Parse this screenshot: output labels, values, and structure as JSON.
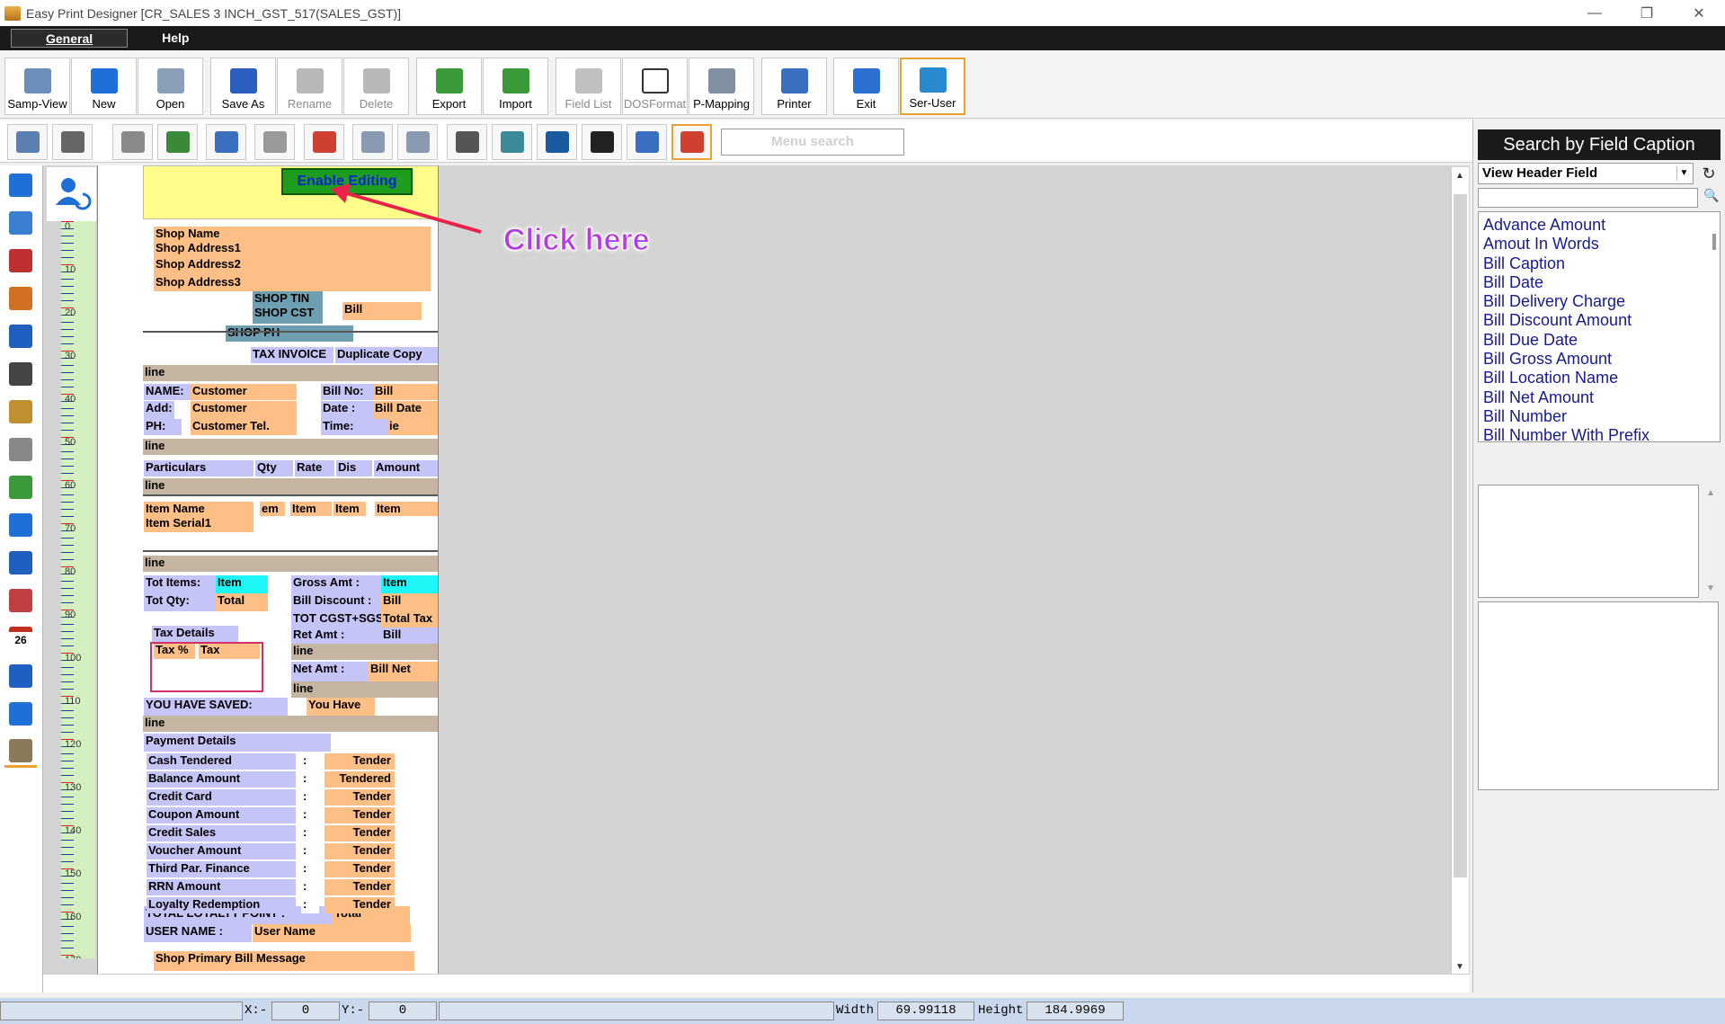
{
  "window": {
    "title": "Easy Print Designer [CR_SALES 3 INCH_GST_517(SALES_GST)]",
    "minimize": "—",
    "restore": "❐",
    "close": "✕"
  },
  "menu": {
    "items": [
      "General",
      "Help"
    ]
  },
  "toolbar": [
    {
      "label": "Samp-View",
      "icon": "magnifier-icon",
      "color": "#6b8fb8"
    },
    {
      "label": "New",
      "icon": "new-doc-icon",
      "color": "#1f6fd6"
    },
    {
      "label": "Open",
      "icon": "open-icon",
      "color": "#8aa0b8"
    },
    {
      "label": "Save As",
      "icon": "floppy-icon",
      "color": "#2a5fc0"
    },
    {
      "label": "Rename",
      "icon": "rename-icon",
      "color": "#b8b8b8"
    },
    {
      "label": "Delete",
      "icon": "delete-icon",
      "color": "#b8b8b8"
    },
    {
      "label": "Export",
      "icon": "export-icon",
      "color": "#3a9a3a"
    },
    {
      "label": "Import",
      "icon": "import-icon",
      "color": "#3a9a3a"
    },
    {
      "label": "Field List",
      "icon": "field-list-icon",
      "color": "#c0c0c0"
    },
    {
      "label": "DOSFormat",
      "icon": "dos-format-icon",
      "color": "#ffffff"
    },
    {
      "label": "P-Mapping",
      "icon": "mapping-icon",
      "color": "#8090a0"
    },
    {
      "label": "Printer",
      "icon": "printer-icon",
      "color": "#3a6fc0"
    },
    {
      "label": "Exit",
      "icon": "exit-icon",
      "color": "#2a70d0"
    },
    {
      "label": "Ser-User",
      "icon": "user-icon",
      "color": "#2a8ad0"
    }
  ],
  "toolbar2": {
    "icons": [
      "preview-icon",
      "print-icon",
      "text-edit-icon",
      "excel-icon",
      "printer-settings-icon",
      "document-clock-icon",
      "sitemap-icon",
      "cloud-upload-icon",
      "cloud-download-icon",
      "eraser-icon",
      "network-icon",
      "globe-icon",
      "chip-icon",
      "print-setup-icon",
      "print-active-icon"
    ],
    "menu_search_placeholder": "Menu search"
  },
  "left_tools": [
    "text-insert-icon",
    "layout-icon",
    "pen-icon",
    "pencil-icon",
    "dots-icon",
    "page-icon",
    "edit-doc-icon",
    "note-icon",
    "image-add-icon",
    "numbered-list-icon",
    "doc-list-icon",
    "pie-icon",
    "calendar-icon",
    "report-icon",
    "percent-icon",
    "coins-icon"
  ],
  "left_tool_calendar_text": "26",
  "designer": {
    "enable_editing": "Enable Editing",
    "ruler": [
      "0",
      "10",
      "20",
      "30",
      "40",
      "50",
      "60",
      "70",
      "80",
      "90",
      "100",
      "110",
      "120",
      "130",
      "140",
      "150",
      "160",
      "170"
    ],
    "fields": {
      "shop_name": "Shop Name",
      "addr1": "Shop Address1",
      "addr2": "Shop Address2",
      "addr3": "Shop Address3",
      "tin": "SHOP TIN",
      "cst": "SHOP CST",
      "bill": "Bill",
      "ph": "SHOP PH",
      "tax_invoice": "TAX INVOICE",
      "dup_copy": "Duplicate Copy",
      "line": "line",
      "name_l": "NAME:",
      "name_v": "Customer",
      "add_l": "Add:",
      "add_v": "Customer",
      "ph_l": "PH:",
      "ph_v": "Customer Tel.",
      "billno_l": "Bill No:",
      "billno_v": "Bill",
      "date_l": "Date  :",
      "date_v": "Bill Date",
      "time_l": "Time:",
      "time_v": "ie",
      "particulars": "Particulars",
      "qty": "Qty",
      "rate": "Rate",
      "dis": "Dis",
      "amount": "Amount",
      "item_name": "Item Name",
      "item_serial": "Item Serial1",
      "em": "em",
      "item1": "Item",
      "item2": "Item",
      "item3": "Item",
      "tot_items_l": "Tot Items:",
      "tot_items_v": "Item",
      "tot_qty_l": "Tot Qty:",
      "tot_qty_v": "Total",
      "gross_l": "Gross Amt :",
      "gross_v": "Item",
      "disc_l": "Bill Discount :",
      "disc_v": "Bill",
      "tot_cgst_l": "TOT CGST+SGS",
      "tot_cgst_v": "Total Tax",
      "ret_l": "Ret Amt :",
      "ret_v": "Bill",
      "tax_details": "Tax Details",
      "tax_pct": "Tax %",
      "tax": "Tax",
      "net_l": "Net Amt :",
      "net_v": "Bill Net",
      "saved_l": "YOU HAVE SAVED:",
      "saved_v": "You Have",
      "payment": "Payment Details",
      "pay_rows": [
        {
          "label": "Cash Tendered",
          "value": "Tender"
        },
        {
          "label": "Balance Amount",
          "value": "Tendered"
        },
        {
          "label": "Credit Card",
          "value": "Tender"
        },
        {
          "label": "Coupon Amount",
          "value": "Tender"
        },
        {
          "label": "Credit Sales",
          "value": "Tender"
        },
        {
          "label": "Voucher Amount",
          "value": "Tender"
        },
        {
          "label": "Third Par. Finance",
          "value": "Tender"
        },
        {
          "label": "RRN Amount",
          "value": "Tender"
        },
        {
          "label": "Loyalty Redemption",
          "value": "Tender"
        }
      ],
      "colon": ":",
      "loyalty_l": "TOTAL LOYALTY POINT :",
      "loyalty_v": "Total",
      "user_l": "USER NAME :",
      "user_v": "User Name",
      "primary_msg": "Shop Primary Bill Message"
    }
  },
  "callout": "Click here",
  "right_panel": {
    "title": "Search by Field Caption",
    "dropdown": "View Header Field",
    "fields": [
      "Advance Amount",
      "Amout In Words",
      "Bill Caption",
      "Bill Date",
      "Bill Delivery Charge",
      "Bill Discount Amount",
      "Bill Due Date",
      "Bill Gross Amount",
      "Bill Location Name",
      "Bill Net Amount",
      "Bill Number",
      "Bill Number With Prefix"
    ]
  },
  "status": {
    "x_label": "X:-",
    "x": "0",
    "y_label": "Y:-",
    "y": "0",
    "width_label": "Width",
    "width": "69.99118",
    "height_label": "Height",
    "height": "184.9969"
  },
  "colors": {
    "accent_orange": "#f0a030",
    "field_orange": "#fdbf85",
    "field_blue": "#c4c4f7",
    "header_yellow": "#fffe8a",
    "callout_purple": "#b43de0",
    "arrow_red": "#e8224a"
  }
}
